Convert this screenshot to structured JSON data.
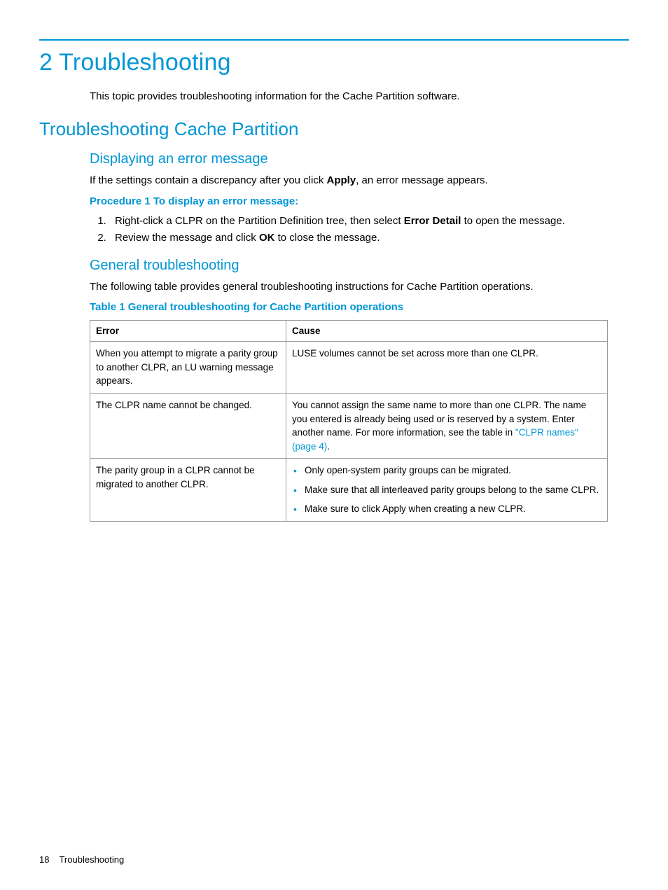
{
  "chapter": {
    "title": "2 Troubleshooting",
    "intro": "This topic provides troubleshooting information for the Cache Partition software."
  },
  "section": {
    "title": "Troubleshooting Cache Partition"
  },
  "subsection1": {
    "title": "Displaying an error message",
    "body_before": "If the settings contain a discrepancy after you click ",
    "body_bold": "Apply",
    "body_after": ", an error message appears.",
    "procedure_heading": "Procedure 1 To display an error message:",
    "steps": {
      "s1_before": "Right-click a CLPR on the Partition Definition tree, then select ",
      "s1_bold": "Error Detail",
      "s1_after": " to open the message.",
      "s2_before": "Review the message and click ",
      "s2_bold": "OK",
      "s2_after": " to close the message."
    }
  },
  "subsection2": {
    "title": "General troubleshooting",
    "body": "The following table provides general troubleshooting instructions for Cache Partition operations.",
    "table_title": "Table 1 General troubleshooting for Cache Partition operations",
    "headers": {
      "error": "Error",
      "cause": "Cause"
    },
    "rows": {
      "r1": {
        "error": "When you attempt to migrate a parity group to another CLPR, an LU warning message appears.",
        "cause": "LUSE volumes cannot be set across more than one CLPR."
      },
      "r2": {
        "error": "The CLPR name cannot be changed.",
        "cause_before": "You cannot assign the same name to more than one CLPR. The name you entered is already being used or is reserved by a system. Enter another name. For more information, see the table in ",
        "cause_link": "\"CLPR names\" (page 4)",
        "cause_after": "."
      },
      "r3": {
        "error": "The parity group in a CLPR cannot be migrated to another CLPR.",
        "bullets": {
          "b1": "Only open-system parity groups can be migrated.",
          "b2": "Make sure that all interleaved parity groups belong to the same CLPR.",
          "b3": "Make sure to click Apply when creating a new CLPR."
        }
      }
    }
  },
  "footer": {
    "page_number": "18",
    "section_label": "Troubleshooting"
  }
}
